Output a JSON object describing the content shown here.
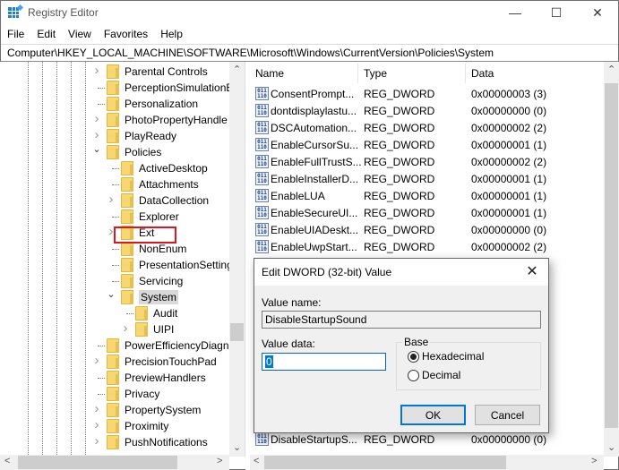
{
  "window": {
    "title": "Registry Editor",
    "controls": {
      "minimize": "—",
      "maximize": "☐",
      "close": "✕"
    }
  },
  "menu": [
    "File",
    "Edit",
    "View",
    "Favorites",
    "Help"
  ],
  "address": "Computer\\HKEY_LOCAL_MACHINE\\SOFTWARE\\Microsoft\\Windows\\CurrentVersion\\Policies\\System",
  "tree": {
    "items": [
      {
        "label": "Parental Controls",
        "level": 0,
        "expander": "collapsed"
      },
      {
        "label": "PerceptionSimulationE",
        "level": 0,
        "expander": "none"
      },
      {
        "label": "Personalization",
        "level": 0,
        "expander": "none"
      },
      {
        "label": "PhotoPropertyHandle",
        "level": 0,
        "expander": "collapsed"
      },
      {
        "label": "PlayReady",
        "level": 0,
        "expander": "collapsed"
      },
      {
        "label": "Policies",
        "level": 0,
        "expander": "expanded"
      },
      {
        "label": "ActiveDesktop",
        "level": 1,
        "expander": "none"
      },
      {
        "label": "Attachments",
        "level": 1,
        "expander": "none"
      },
      {
        "label": "DataCollection",
        "level": 1,
        "expander": "collapsed"
      },
      {
        "label": "Explorer",
        "level": 1,
        "expander": "none"
      },
      {
        "label": "Ext",
        "level": 1,
        "expander": "collapsed"
      },
      {
        "label": "NonEnum",
        "level": 1,
        "expander": "none"
      },
      {
        "label": "PresentationSetting",
        "level": 1,
        "expander": "none"
      },
      {
        "label": "Servicing",
        "level": 1,
        "expander": "none"
      },
      {
        "label": "System",
        "level": 1,
        "expander": "expanded",
        "selected": true
      },
      {
        "label": "Audit",
        "level": 2,
        "expander": "none"
      },
      {
        "label": "UIPI",
        "level": 2,
        "expander": "collapsed"
      },
      {
        "label": "PowerEfficiencyDiagn",
        "level": 0,
        "expander": "none"
      },
      {
        "label": "PrecisionTouchPad",
        "level": 0,
        "expander": "collapsed"
      },
      {
        "label": "PreviewHandlers",
        "level": 0,
        "expander": "none"
      },
      {
        "label": "Privacy",
        "level": 0,
        "expander": "none"
      },
      {
        "label": "PropertySystem",
        "level": 0,
        "expander": "collapsed"
      },
      {
        "label": "Proximity",
        "level": 0,
        "expander": "collapsed"
      },
      {
        "label": "PushNotifications",
        "level": 0,
        "expander": "collapsed"
      }
    ]
  },
  "list": {
    "columns": [
      "Name",
      "Type",
      "Data"
    ],
    "rows": [
      {
        "name": "ConsentPrompt...",
        "type": "REG_DWORD",
        "data": "0x00000003 (3)"
      },
      {
        "name": "dontdisplaylastu...",
        "type": "REG_DWORD",
        "data": "0x00000000 (0)"
      },
      {
        "name": "DSCAutomation...",
        "type": "REG_DWORD",
        "data": "0x00000002 (2)"
      },
      {
        "name": "EnableCursorSu...",
        "type": "REG_DWORD",
        "data": "0x00000001 (1)"
      },
      {
        "name": "EnableFullTrustS...",
        "type": "REG_DWORD",
        "data": "0x00000002 (2)"
      },
      {
        "name": "EnableInstallerD...",
        "type": "REG_DWORD",
        "data": "0x00000001 (1)"
      },
      {
        "name": "EnableLUA",
        "type": "REG_DWORD",
        "data": "0x00000001 (1)"
      },
      {
        "name": "EnableSecureUI...",
        "type": "REG_DWORD",
        "data": "0x00000001 (1)"
      },
      {
        "name": "EnableUIADeskt...",
        "type": "REG_DWORD",
        "data": "0x00000000 (0)"
      },
      {
        "name": "EnableUwpStart...",
        "type": "REG_DWORD",
        "data": "0x00000002 (2)"
      }
    ],
    "partial_row": {
      "name": "DisableStartupS...",
      "type": "REG_DWORD",
      "data": "0x00000000 (0)"
    }
  },
  "dialog": {
    "title": "Edit DWORD (32-bit) Value",
    "value_name_label": "Value name:",
    "value_name": "DisableStartupSound",
    "value_data_label": "Value data:",
    "value_data": "0",
    "base_label": "Base",
    "base_options": [
      {
        "label": "Hexadecimal",
        "checked": true
      },
      {
        "label": "Decimal",
        "checked": false
      }
    ],
    "ok_label": "OK",
    "cancel_label": "Cancel",
    "close_glyph": "✕"
  },
  "highlight_color": "#e0141e"
}
